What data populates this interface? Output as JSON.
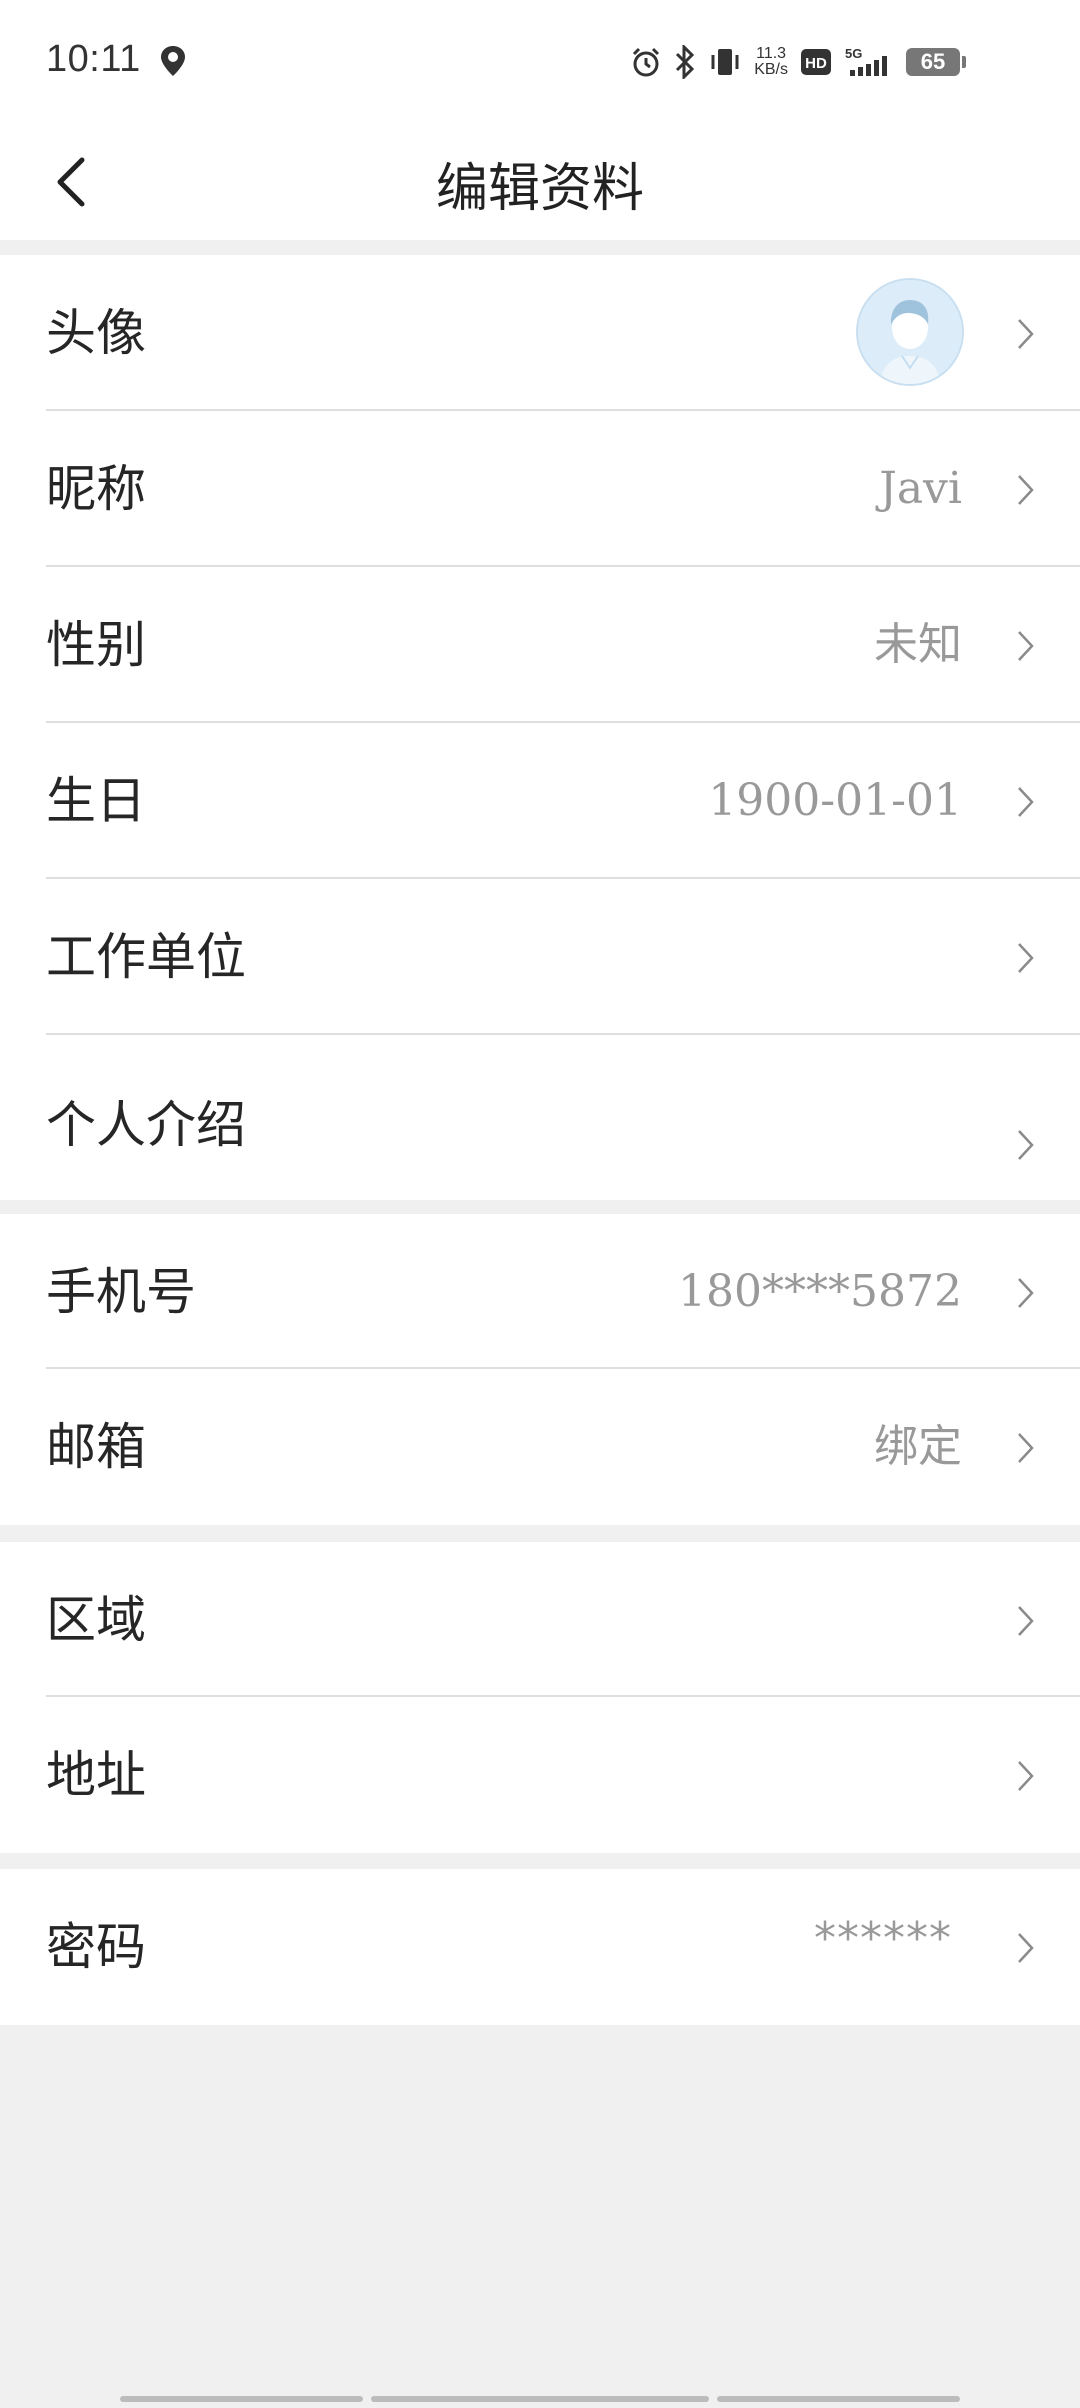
{
  "status_bar": {
    "time": "10:11",
    "speed_value": "11.3",
    "speed_unit": "KB/s",
    "network": "5G",
    "hd": "HD",
    "battery": "65"
  },
  "header": {
    "title": "编辑资料"
  },
  "sections": [
    {
      "rows": [
        {
          "label": "头像",
          "type": "avatar"
        },
        {
          "label": "昵称",
          "value": "Javi"
        },
        {
          "label": "性别",
          "value": "未知"
        },
        {
          "label": "生日",
          "value": "1900-01-01"
        },
        {
          "label": "工作单位",
          "value": ""
        },
        {
          "label": "个人介绍",
          "value": ""
        }
      ]
    },
    {
      "rows": [
        {
          "label": "手机号",
          "value": "180****5872"
        },
        {
          "label": "邮箱",
          "value": "绑定"
        }
      ]
    },
    {
      "rows": [
        {
          "label": "区域",
          "value": ""
        },
        {
          "label": "地址",
          "value": ""
        }
      ]
    },
    {
      "rows": [
        {
          "label": "密码",
          "value": "******"
        }
      ]
    }
  ],
  "colors": {
    "background": "#f0f0f0",
    "surface": "#ffffff",
    "label_text": "#262626",
    "value_text": "#999999",
    "divider": "#dedede"
  }
}
